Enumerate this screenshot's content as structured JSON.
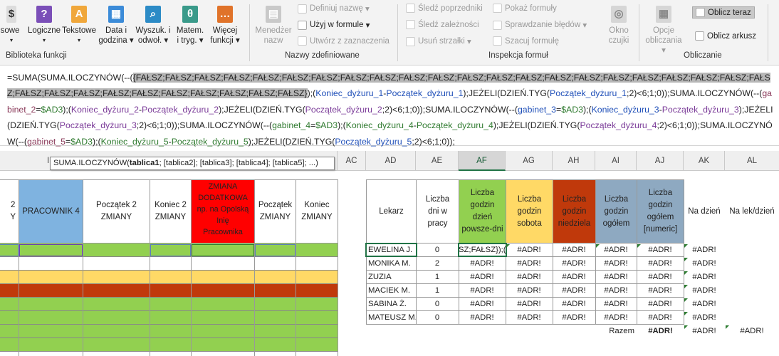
{
  "ribbon": {
    "func_library": {
      "buttons": [
        {
          "label_l1": "sowe Pola",
          "label_l2": "",
          "icon": "text-icon",
          "color": ""
        },
        {
          "label_l1": "Logiczne",
          "label_l2": "",
          "icon": "logical-icon",
          "color": "#7b4fb8"
        },
        {
          "label_l1": "Tekstowe",
          "label_l2": "",
          "icon": "text-icon",
          "color": "#f0a73b"
        },
        {
          "label_l1": "Data i",
          "label_l2": "godzina",
          "icon": "date-icon",
          "color": "#3b8bd8"
        },
        {
          "label_l1": "Wyszuk. i",
          "label_l2": "odwoł.",
          "icon": "lookup-icon",
          "color": "#2c8bc6"
        },
        {
          "label_l1": "Matem.",
          "label_l2": "i tryg.",
          "icon": "math-icon",
          "color": "#3a9a8a"
        },
        {
          "label_l1": "Więcej",
          "label_l2": "funkcji",
          "icon": "more-functions-icon",
          "color": "#e0732a"
        }
      ],
      "group_label": "Biblioteka funkcji"
    },
    "names": {
      "manager_l1": "Menedżer",
      "manager_l2": "nazw",
      "define": "Definiuj nazwę",
      "use_in_formula": "Użyj w formule",
      "create_from_selection": "Utwórz z zaznaczenia",
      "group_label": "Nazwy zdefiniowane"
    },
    "audit": {
      "trace_precedents": "Śledź poprzedniki",
      "trace_dependents": "Śledź zależności",
      "remove_arrows": "Usuń strzałki",
      "show_formulas": "Pokaż formuły",
      "error_checking": "Sprawdzanie błędów",
      "evaluate": "Szacuj formułę",
      "watch_l1": "Okno",
      "watch_l2": "czujki",
      "group_label": "Inspekcja formuł"
    },
    "calc": {
      "options_l1": "Opcje",
      "options_l2": "obliczania",
      "calc_now": "Oblicz teraz",
      "calc_sheet": "Oblicz arkusz",
      "group_label": "Obliczanie"
    }
  },
  "formula": {
    "p01": "=SUMA(SUMA.ILOCZYNÓW(--(",
    "p02": "{FAŁSZ;FAŁSZ;FAŁSZ;FAŁSZ;FAŁSZ;FAŁSZ;FAŁSZ;FAŁSZ;FAŁSZ;FAŁSZ;FAŁSZ;FAŁSZ;FAŁSZ;FAŁSZ;FAŁSZ;FAŁSZ;FAŁSZ;FAŁSZ;FAŁSZ;FAŁSZ;FAŁSZ;FAŁSZ;FAŁSZ;FAŁSZ;FAŁSZ;FAŁSZ;FAŁSZ;FAŁSZ;FAŁSZ;FAŁSZ;FAŁSZ;FAŁSZ}",
    "p03": ");(",
    "p04": "Koniec_dyżuru_1",
    "p05": "-",
    "p06": "Początek_dyżuru_1",
    "p07": ");JEŻELI(DZIEŃ.TYG(",
    "p08": "Początek_dyżuru_1",
    "p09": ";2)<6;1;0));SUMA.ILOCZYNÓW(--(",
    "p10": "gabinet_2",
    "p11": "=",
    "p12": "$AD3",
    "p13": ");(",
    "p14": "Koniec_dyżuru_2",
    "p15": "-",
    "p16": "Początek_dyżuru_2",
    "p17": ");JEŻELI(DZIEŃ.TYG(",
    "p18": "Początek_dyżuru_2",
    "p19": ";2)<6;1;0));SUMA.ILOCZYNÓW(--(",
    "p20": "gabinet_3",
    "p21": "=",
    "p22": "$AD3",
    "p23": ");(",
    "p24": "Koniec_dyżuru_3",
    "p25": "-",
    "p26": "Początek_dyżuru_3",
    "p27": ");JEŻELI(DZIEŃ.TYG(",
    "p28": "Początek_dyżuru_3",
    "p29": ";2)<6;1;0));SUMA.ILOCZYNÓW(--(",
    "p30": "gabinet_4",
    "p31": "=",
    "p32": "$AD3",
    "p33": ");(",
    "p34": "Koniec_dyżuru_4",
    "p35": "-",
    "p36": "Początek_dyżuru_4",
    "p37": ");JEŻELI(DZIEŃ.TYG(",
    "p38": "Początek_dyżuru_4",
    "p39": ";2)<6;1;0));SUMA.ILOCZYNÓW(--(",
    "p40": "gabinet_5",
    "p41": "=",
    "p42": "$AD3",
    "p43": ");(",
    "p44": "Koniec_dyżuru_5",
    "p45": "-",
    "p46": "Początek_dyżuru_5",
    "p47": ");JEŻELI(DZIEŃ.TYG(",
    "p48": "Początek_dyżuru_5",
    "p49": ";2)<6;1;0));"
  },
  "tooltip": {
    "fn": "SUMA.ILOCZYNÓW(",
    "arg1": "tablica1",
    "rest": "; [tablica2]; [tablica3]; [tablica4]; [tablica5]; ...)"
  },
  "columns": {
    "ac": "AC",
    "ad": "AD",
    "ae": "AE",
    "af": "AF",
    "ag": "AG",
    "ah": "AH",
    "ai": "AI",
    "aj": "AJ",
    "ak": "AK",
    "al": "AL",
    "partial": "I"
  },
  "left_headers": {
    "c1_l1": "2",
    "c1_l2": "Y",
    "c2": "PRACOWNIK 4",
    "c3_l1": "Początek 2",
    "c3_l2": "ZMIANY",
    "c4_l1": "Koniec 2",
    "c4_l2": "ZMIANY",
    "c5_l1": "ZMIANA",
    "c5_l2": "DODATKOWA",
    "c5_l3": "np. na Opolską",
    "c5_l4": "Inię",
    "c5_l5": "Pracownika",
    "c6_l1": "Początek",
    "c6_l2": "ZMIANY",
    "c7_l1": "Koniec",
    "c7_l2": "ZMIANY"
  },
  "table": {
    "headers": {
      "lekarz": "Lekarz",
      "days_l1": "Liczba",
      "days_l2": "dni w",
      "days_l3": "pracy",
      "weekday_l1": "Liczba",
      "weekday_l2": "godzin",
      "weekday_l3": "dzień",
      "weekday_l4": "powsze-dni",
      "sat_l1": "Liczba",
      "sat_l2": "godzin",
      "sat_l3": "sobota",
      "sun_l1": "Liczba",
      "sun_l2": "godzin",
      "sun_l3": "niedziela",
      "total_l1": "Liczba",
      "total_l2": "godzin",
      "total_l3": "ogółem",
      "totaln_l1": "Liczba",
      "totaln_l2": "godzin",
      "totaln_l3": "ogółem",
      "totaln_l4": "[numeric]",
      "per_day": "Na dzień",
      "per_doc_day": "Na lek/dzień"
    },
    "rows": [
      {
        "name": "EWELINA J.",
        "days": "0",
        "af": "SZ;FAŁSZ});(K",
        "ag": "#ADR!",
        "ah": "#ADR!",
        "ai": "#ADR!",
        "aj": "#ADR!",
        "ak": "#ADR!"
      },
      {
        "name": "MONIKA M.",
        "days": "2",
        "af": "#ADR!",
        "ag": "#ADR!",
        "ah": "#ADR!",
        "ai": "#ADR!",
        "aj": "#ADR!",
        "ak": "#ADR!"
      },
      {
        "name": "ZUZIA",
        "days": "1",
        "af": "#ADR!",
        "ag": "#ADR!",
        "ah": "#ADR!",
        "ai": "#ADR!",
        "aj": "#ADR!",
        "ak": "#ADR!"
      },
      {
        "name": "MACIEK M.",
        "days": "1",
        "af": "#ADR!",
        "ag": "#ADR!",
        "ah": "#ADR!",
        "ai": "#ADR!",
        "aj": "#ADR!",
        "ak": "#ADR!"
      },
      {
        "name": "SABINA Ż.",
        "days": "0",
        "af": "#ADR!",
        "ag": "#ADR!",
        "ah": "#ADR!",
        "ai": "#ADR!",
        "aj": "#ADR!",
        "ak": "#ADR!"
      },
      {
        "name": "MATEUSZ M.",
        "days": "0",
        "af": "#ADR!",
        "ag": "#ADR!",
        "ah": "#ADR!",
        "ai": "#ADR!",
        "aj": "#ADR!",
        "ak": "#ADR!"
      }
    ],
    "razem_label": "Razem",
    "razem_aj": "#ADR!",
    "razem_ak": "#ADR!",
    "razem_al": "#ADR!"
  },
  "colors": {
    "weekday_header": "#92d050",
    "saturday_header": "#ffd966",
    "sunday_header": "#c0390b",
    "total_header": "#8ea9c1",
    "pracownik_header": "#7fb3e0",
    "dodatkowa_header": "#ff0000",
    "row_green": "#92d050",
    "row_yellow": "#ffd966",
    "row_red": "#c0390b",
    "selection_green": "#217346"
  }
}
